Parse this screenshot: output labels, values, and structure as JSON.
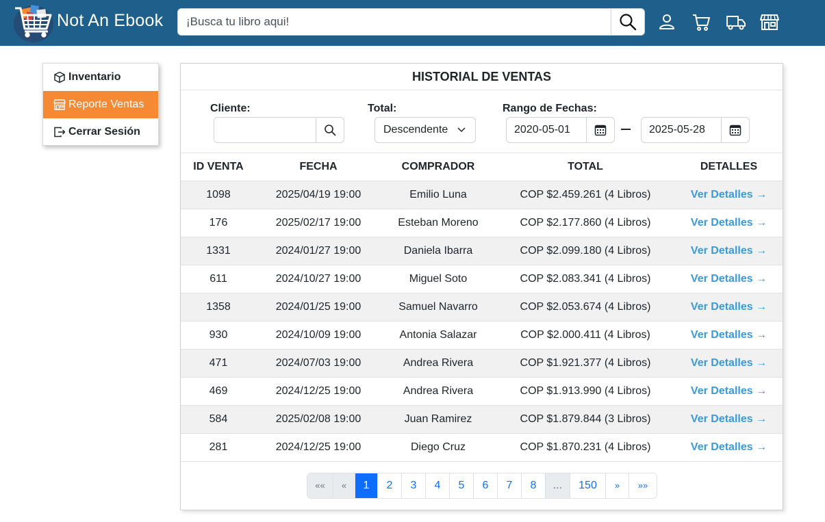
{
  "header": {
    "brand": "Not An Ebook",
    "search_placeholder": "¡Busca tu libro aqui!",
    "icons": [
      "user-icon",
      "cart-icon",
      "truck-icon",
      "store-icon"
    ],
    "color": "#1f5f8b"
  },
  "sidebar": {
    "items": [
      {
        "label": "Inventario",
        "icon": "box-icon",
        "active": false
      },
      {
        "label": "Reporte Ventas",
        "icon": "store-icon",
        "active": true
      },
      {
        "label": "Cerrar Sesión",
        "icon": "logout-icon",
        "active": false
      }
    ],
    "accent": "#f68a34"
  },
  "main": {
    "title": "HISTORIAL DE VENTAS",
    "filters": {
      "client_label": "Cliente:",
      "client_value": "",
      "total_label": "Total:",
      "total_value": "Descendente",
      "range_label": "Rango de Fechas:",
      "date_from": "2020-05-01",
      "date_to": "2025-05-28"
    },
    "columns": [
      "ID VENTA",
      "FECHA",
      "COMPRADOR",
      "TOTAL",
      "DETALLES"
    ],
    "rows": [
      {
        "id": "1098",
        "date": "2025/04/19 19:00",
        "buyer": "Emilio Luna",
        "total": "COP $2.459.261 (4 Libros)",
        "details": "Ver Detalles →"
      },
      {
        "id": "176",
        "date": "2025/02/17 19:00",
        "buyer": "Esteban Moreno",
        "total": "COP $2.177.860 (4 Libros)",
        "details": "Ver Detalles →"
      },
      {
        "id": "1331",
        "date": "2024/01/27 19:00",
        "buyer": "Daniela Ibarra",
        "total": "COP $2.099.180 (4 Libros)",
        "details": "Ver Detalles →"
      },
      {
        "id": "611",
        "date": "2024/10/27 19:00",
        "buyer": "Miguel Soto",
        "total": "COP $2.083.341 (4 Libros)",
        "details": "Ver Detalles →"
      },
      {
        "id": "1358",
        "date": "2024/01/25 19:00",
        "buyer": "Samuel Navarro",
        "total": "COP $2.053.674 (4 Libros)",
        "details": "Ver Detalles →"
      },
      {
        "id": "930",
        "date": "2024/10/09 19:00",
        "buyer": "Antonia Salazar",
        "total": "COP $2.000.411 (4 Libros)",
        "details": "Ver Detalles →"
      },
      {
        "id": "471",
        "date": "2024/07/03 19:00",
        "buyer": "Andrea Rivera",
        "total": "COP $1.921.377 (4 Libros)",
        "details": "Ver Detalles →"
      },
      {
        "id": "469",
        "date": "2024/12/25 19:00",
        "buyer": "Andrea Rivera",
        "total": "COP $1.913.990 (4 Libros)",
        "details": "Ver Detalles →"
      },
      {
        "id": "584",
        "date": "2025/02/08 19:00",
        "buyer": "Juan Ramirez",
        "total": "COP $1.879.844 (3 Libros)",
        "details": "Ver Detalles →"
      },
      {
        "id": "281",
        "date": "2024/12/25 19:00",
        "buyer": "Diego Cruz",
        "total": "COP $1.870.231 (4 Libros)",
        "details": "Ver Detalles →"
      }
    ],
    "pagination": [
      {
        "label": "««",
        "state": "disabled"
      },
      {
        "label": "«",
        "state": "disabled"
      },
      {
        "label": "1",
        "state": "active"
      },
      {
        "label": "2",
        "state": "normal"
      },
      {
        "label": "3",
        "state": "normal"
      },
      {
        "label": "4",
        "state": "normal"
      },
      {
        "label": "5",
        "state": "normal"
      },
      {
        "label": "6",
        "state": "normal"
      },
      {
        "label": "7",
        "state": "normal"
      },
      {
        "label": "8",
        "state": "normal"
      },
      {
        "label": "...",
        "state": "disabled"
      },
      {
        "label": "150",
        "state": "normal"
      },
      {
        "label": "»",
        "state": "normal"
      },
      {
        "label": "»»",
        "state": "normal"
      }
    ],
    "link_color": "#3a9ad9",
    "active_page_color": "#0d6efd"
  }
}
